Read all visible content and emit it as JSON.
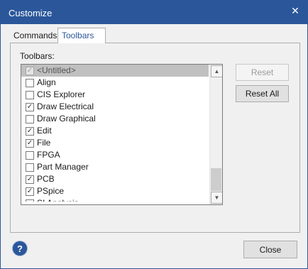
{
  "window": {
    "title": "Customize"
  },
  "tabs": [
    {
      "label": "Commands"
    },
    {
      "label": "Toolbars"
    }
  ],
  "panel": {
    "list_label": "Toolbars:",
    "items": [
      {
        "label": "<Untitled>",
        "checked": true,
        "selected": true,
        "disabled": true
      },
      {
        "label": "Align",
        "checked": false
      },
      {
        "label": "CIS Explorer",
        "checked": false
      },
      {
        "label": "Draw Electrical",
        "checked": true
      },
      {
        "label": "Draw Graphical",
        "checked": false
      },
      {
        "label": "Edit",
        "checked": true
      },
      {
        "label": "File",
        "checked": true
      },
      {
        "label": "FPGA",
        "checked": false
      },
      {
        "label": "Part Manager",
        "checked": false
      },
      {
        "label": "PCB",
        "checked": true
      },
      {
        "label": "PSpice",
        "checked": true
      },
      {
        "label": "SI Analysis",
        "checked": false,
        "clipped": true
      }
    ],
    "buttons": {
      "reset": "Reset",
      "reset_all": "Reset All"
    }
  },
  "footer": {
    "help_icon": "?",
    "close_label": "Close"
  },
  "colors": {
    "accent": "#2b579a",
    "selection": "#c0c0c0"
  }
}
